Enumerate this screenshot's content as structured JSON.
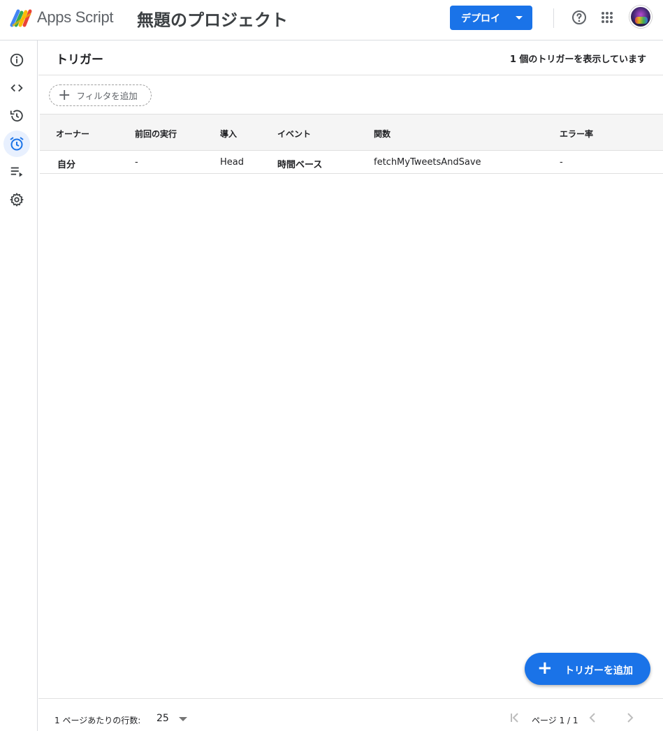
{
  "header": {
    "app_name": "Apps Script",
    "project_title": "無題のプロジェクト",
    "deploy_label": "デプロイ"
  },
  "rail": {
    "items": [
      {
        "name": "overview",
        "icon": "info-icon"
      },
      {
        "name": "editor",
        "icon": "code-icon"
      },
      {
        "name": "executions",
        "icon": "history-icon"
      },
      {
        "name": "triggers",
        "icon": "alarm-icon",
        "active": true
      },
      {
        "name": "executions-list",
        "icon": "playlist-play-icon"
      },
      {
        "name": "settings",
        "icon": "gear-icon"
      }
    ]
  },
  "page": {
    "title": "トリガー",
    "count_text": "1 個のトリガーを表示しています",
    "filter_label": "フィルタを追加"
  },
  "table": {
    "headers": [
      "オーナー",
      "前回の実行",
      "導入",
      "イベント",
      "関数",
      "エラー率"
    ],
    "rows": [
      {
        "owner": "自分",
        "last_run": "-",
        "deployment": "Head",
        "event": "時間ベース",
        "function": "fetchMyTweetsAndSave",
        "error_rate": "-"
      }
    ]
  },
  "fab": {
    "label": "トリガーを追加"
  },
  "footer": {
    "rows_per_page_label": "1 ページあたりの行数:",
    "rows_per_page_value": "25",
    "page_label": "ページ 1 / 1"
  },
  "colors": {
    "accent": "#1a73e8",
    "active_rail": "#e8f0fe"
  }
}
